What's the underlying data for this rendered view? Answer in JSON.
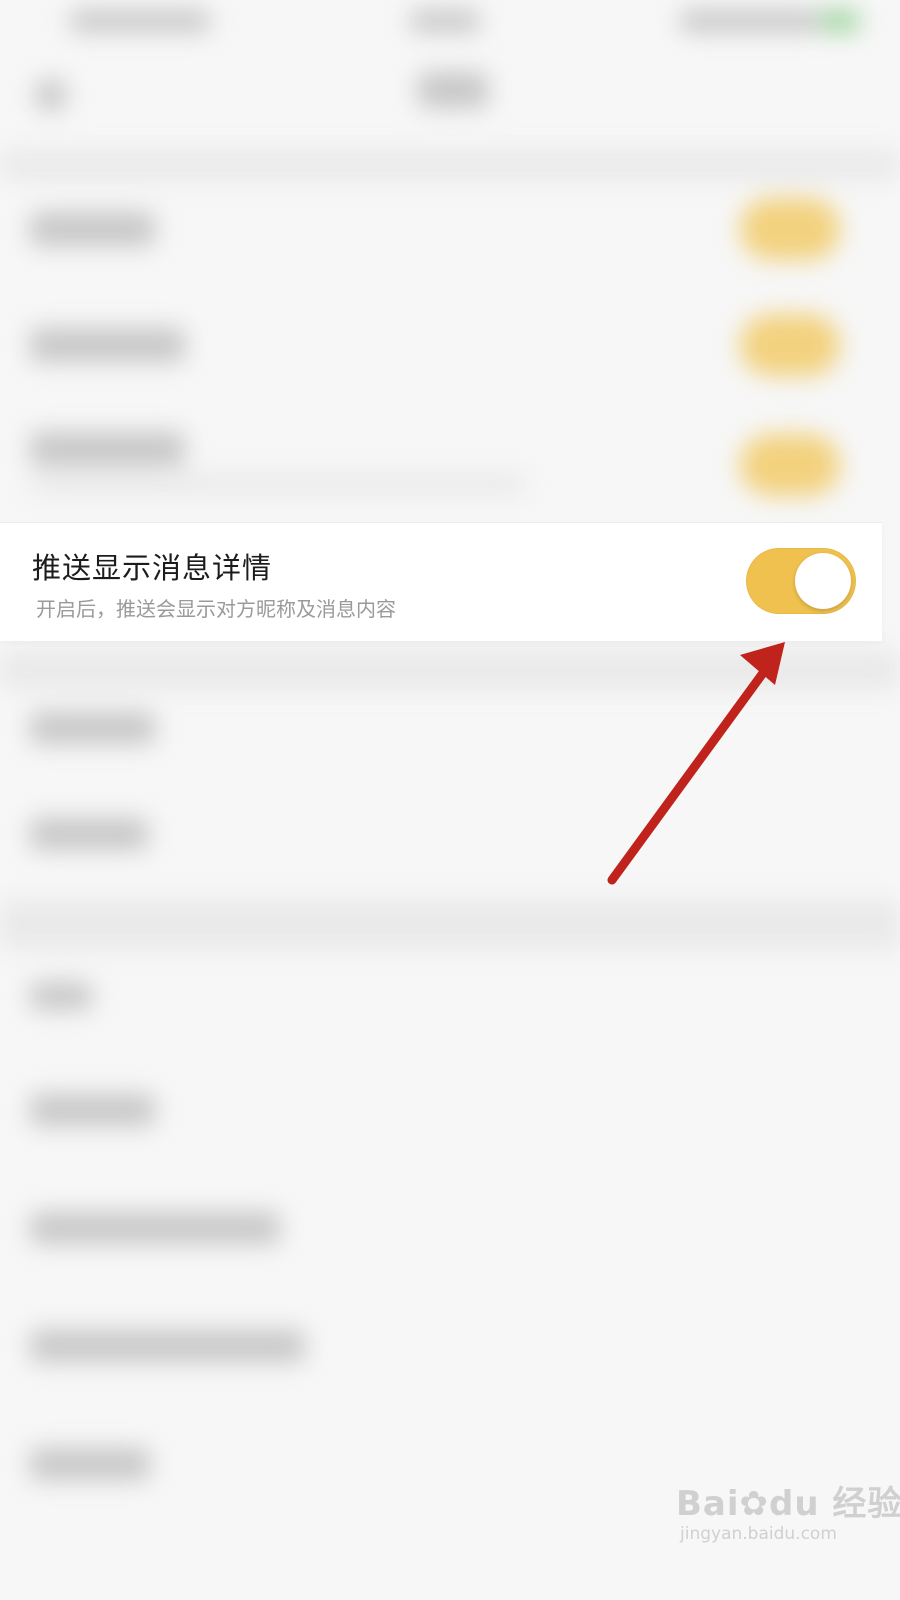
{
  "setting": {
    "title": "推送显示消息详情",
    "description": "开启后，推送会显示对方昵称及消息内容",
    "enabled": true,
    "accent_color": "#f0c14e"
  },
  "annotation": {
    "color": "#c0221c",
    "icon": "arrow-pointer"
  },
  "watermark": {
    "brand_left": "Bai",
    "brand_right": "du",
    "brand_cn": "经验",
    "url": "jingyan.baidu.com"
  }
}
